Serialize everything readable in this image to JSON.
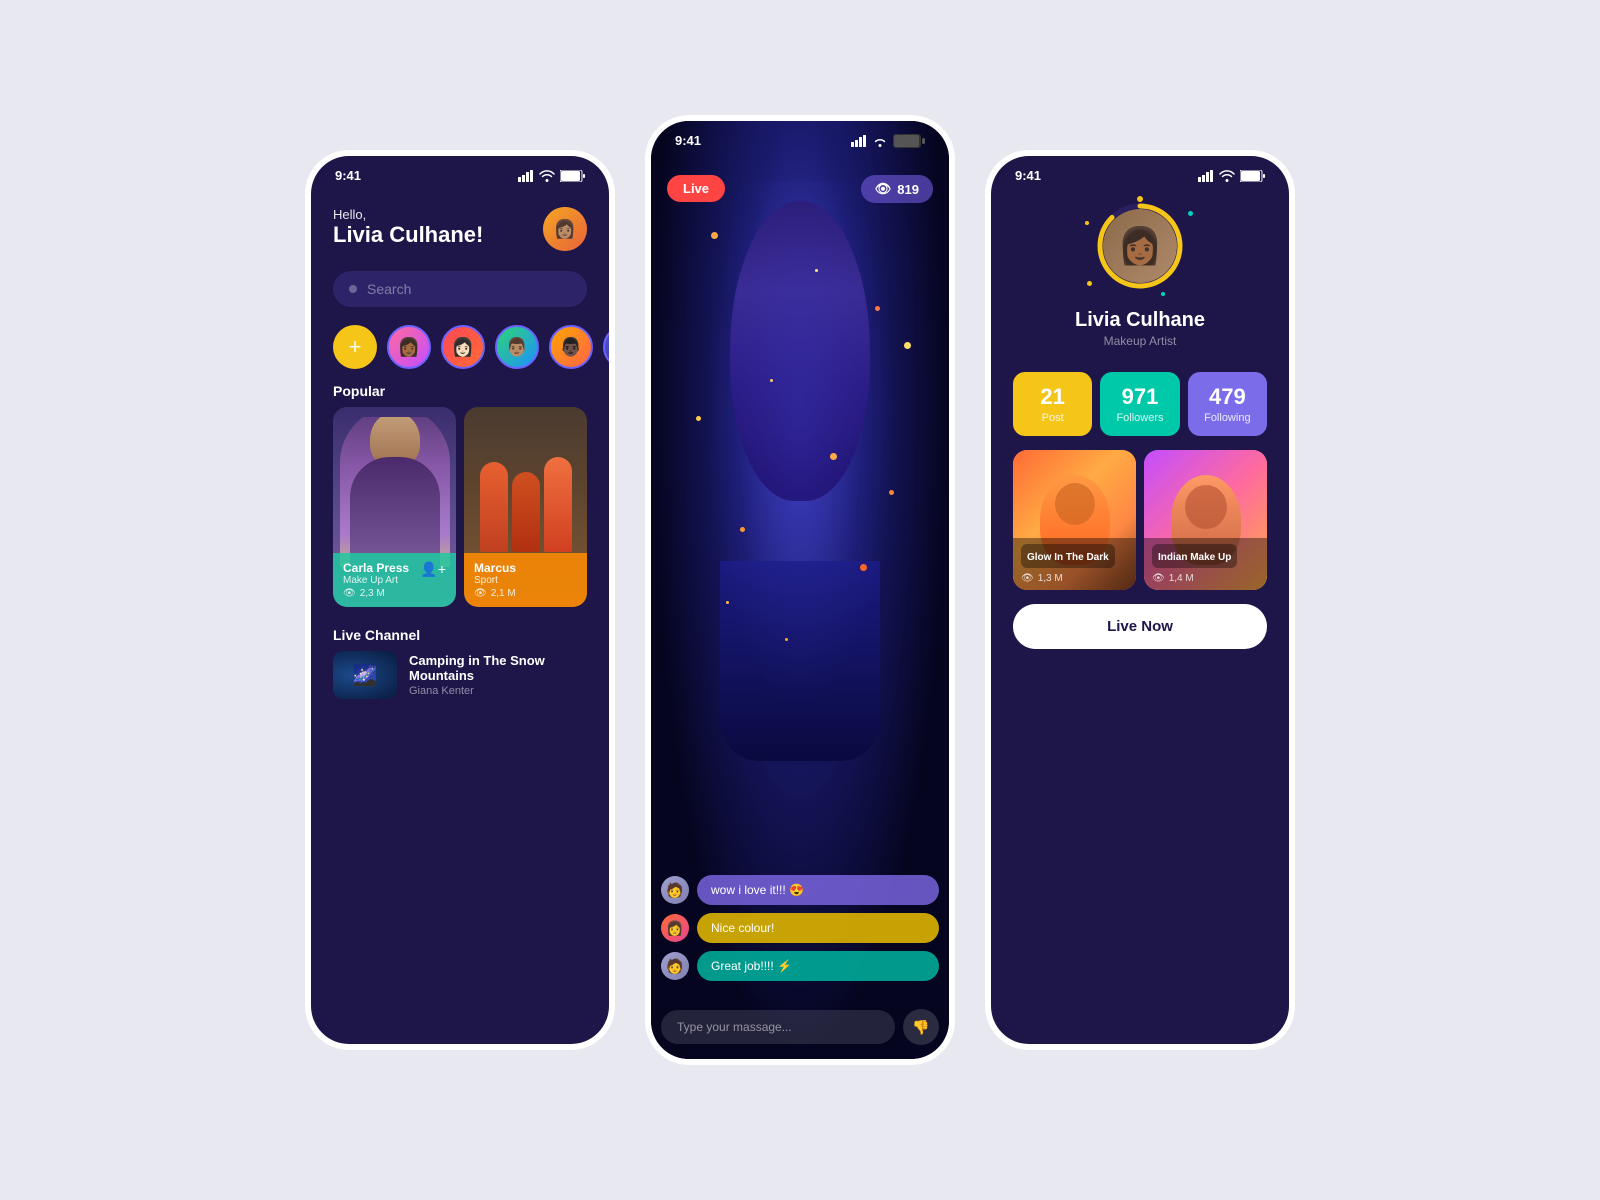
{
  "app": {
    "time": "9:41"
  },
  "phone1": {
    "greeting_hello": "Hello,",
    "greeting_name": "Livia Culhane!",
    "search_placeholder": "Search",
    "section_popular": "Popular",
    "section_live": "Live Channel",
    "cards": [
      {
        "name": "Carla Press",
        "category": "Make Up Art",
        "views": "2,3 M"
      },
      {
        "name": "Marcus",
        "category": "Sport",
        "views": "2,1 M"
      }
    ],
    "live_channel": {
      "title": "Camping in The Snow Mountains",
      "author": "Giana Kenter"
    }
  },
  "phone2": {
    "live_label": "Live",
    "viewer_count": "819",
    "chat": [
      {
        "text": "wow i love it!!! 😍"
      },
      {
        "text": "Nice colour!"
      },
      {
        "text": "Great job!!!! ⚡"
      }
    ],
    "input_placeholder": "Type your massage..."
  },
  "phone3": {
    "user_name": "Livia Culhane",
    "user_title": "Makeup Artist",
    "stats": [
      {
        "number": "21",
        "label": "Post"
      },
      {
        "number": "971",
        "label": "Followers"
      },
      {
        "number": "479",
        "label": "Following"
      }
    ],
    "gallery": [
      {
        "title": "Glow In The Dark",
        "views": "1,3 M"
      },
      {
        "title": "Indian Make Up",
        "views": "1,4 M"
      }
    ],
    "live_now_btn": "Live Now"
  }
}
